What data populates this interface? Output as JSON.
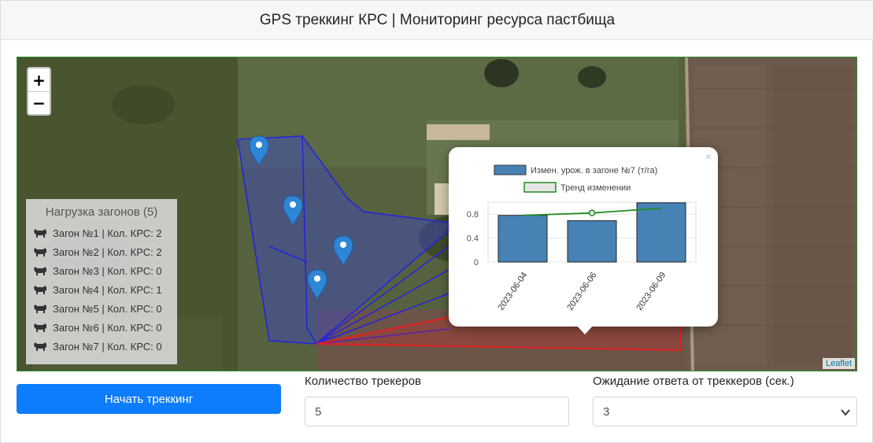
{
  "header": {
    "title": "GPS треккинг КРС | Мониторинг ресурса пастбища"
  },
  "map": {
    "zoom_in": "+",
    "zoom_out": "−",
    "attribution": "Leaflet",
    "legend": {
      "title": "Нагрузка загонов (5)",
      "rows": [
        "Загон №1 | Кол. КРС: 2",
        "Загон №2 | Кол. КРС: 2",
        "Загон №3 | Кол. КРС: 0",
        "Загон №4 | Кол. КРС: 1",
        "Загон №5 | Кол. КРС: 0",
        "Загон №6 | Кол. КРС: 0",
        "Загон №7 | Кол. КРС: 0"
      ]
    },
    "popup": {
      "close": "×"
    }
  },
  "chart_data": {
    "type": "bar",
    "categories": [
      "2023-06-04",
      "2023-06-06",
      "2023-06-09"
    ],
    "series": [
      {
        "name": "Измен. урож. в загоне №7 (т/га)",
        "type": "bar",
        "values": [
          0.78,
          0.69,
          0.99
        ],
        "color": "#4682b4"
      },
      {
        "name": "Тренд изменении",
        "type": "line",
        "values": [
          0.78,
          0.82,
          0.9
        ],
        "color": "#228b22"
      }
    ],
    "yticks": [
      "0.8",
      "0.4",
      "0"
    ],
    "ylim": [
      0,
      1.0
    ],
    "legend_placement": "top"
  },
  "controls": {
    "start_button": "Начать треккинг",
    "trackers_label": "Количество трекеров",
    "trackers_value": "5",
    "timeout_label": "Ожидание ответа от треккеров (сек.)",
    "timeout_value": "3"
  },
  "colors": {
    "accent": "#0d7dfd",
    "polygon": "#3535c8",
    "polygon_red": "#e02020"
  }
}
